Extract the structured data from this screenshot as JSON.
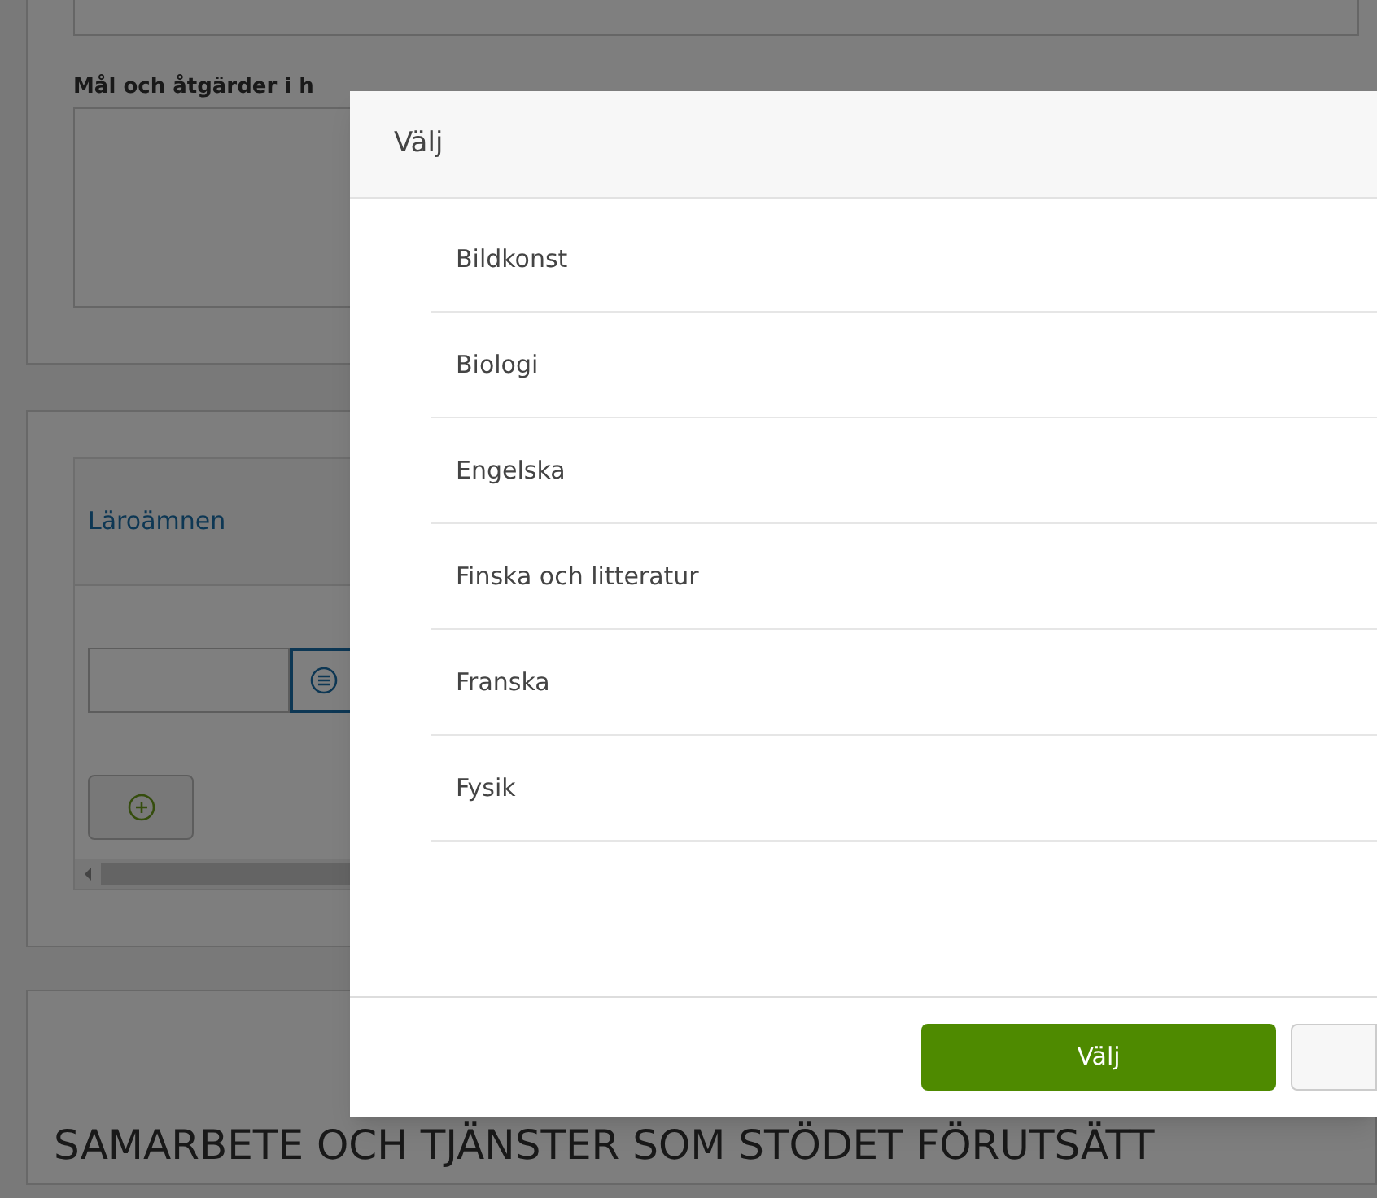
{
  "background": {
    "goals_label": "Mål och åtgärder i h",
    "table_header": "Läroämnen",
    "section_heading": "SAMARBETE OCH TJÄNSTER SOM STÖDET FÖRUTSÄTT"
  },
  "dialog": {
    "title": "Välj",
    "items": [
      {
        "label": "Bildkonst"
      },
      {
        "label": "Biologi"
      },
      {
        "label": "Engelska"
      },
      {
        "label": "Finska och litteratur"
      },
      {
        "label": "Franska"
      },
      {
        "label": "Fysik"
      }
    ],
    "confirm_button": "Välj"
  }
}
